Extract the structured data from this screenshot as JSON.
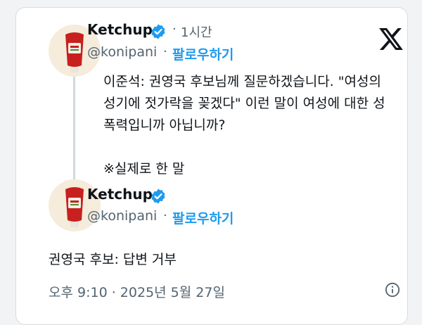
{
  "quoted_tweet": {
    "author_name": "Ketchup",
    "handle": "@konipani",
    "dot": "·",
    "time_ago": "1시간",
    "follow_label": "팔로우하기",
    "text_lines": [
      "이준석: 권영국 후보님께 질문하겠습니다. \"여성의",
      "성기에 젓가락을 꽂겠다\" 이런 말이 여성에 대한 성",
      "폭력입니까 아닙니까?",
      "",
      "※실제로 한 말"
    ]
  },
  "reply_tweet": {
    "author_name": "Ketchup",
    "handle": "@konipani",
    "dot": "·",
    "follow_label": "팔로우하기",
    "text": "권영국 후보: 답변 거부",
    "timestamp": "오후 9:10 · 2025년 5월 27일"
  },
  "icons": {
    "platform_logo": "x-logo-icon",
    "verified": "verified-badge-icon",
    "info": "info-icon",
    "avatar": "ketchup-bottle-avatar"
  },
  "colors": {
    "link_blue": "#1d9bf0",
    "verified_blue": "#1d9bf0",
    "secondary_text": "#536471",
    "thread_line": "#cfd9de"
  }
}
